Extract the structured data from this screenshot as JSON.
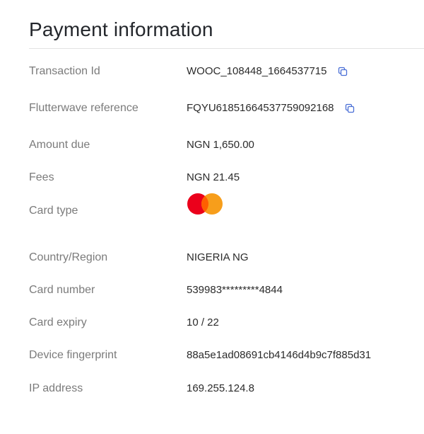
{
  "title": "Payment information",
  "colors": {
    "label": "#7b7b7b",
    "value": "#2b2b2b",
    "copy_icon": "#4a6fd6",
    "mastercard_red": "#eb001b",
    "mastercard_orange": "#f79e1b",
    "mastercard_overlap": "#ff5f00"
  },
  "fields": {
    "transaction_id": {
      "label": "Transaction Id",
      "value": "WOOC_108448_1664537715",
      "icon": "copy-icon"
    },
    "flutterwave_reference": {
      "label": "Flutterwave reference",
      "value": "FQYU618516645377590921​68",
      "icon": "copy-icon"
    },
    "amount_due": {
      "label": "Amount due",
      "value": "NGN 1,650.00"
    },
    "fees": {
      "label": "Fees",
      "value": "NGN 21.45"
    },
    "card_type": {
      "label": "Card type",
      "icon": "mastercard-logo-icon"
    },
    "country_region": {
      "label": "Country/Region",
      "value": "NIGERIA NG"
    },
    "card_number": {
      "label": "Card number",
      "value": "539983*********4844"
    },
    "card_expiry": {
      "label": "Card expiry",
      "value": "10 / 22"
    },
    "device_fingerprint": {
      "label": "Device fingerprint",
      "value": "88a5e1ad08691cb4146d4b9c7f885d31"
    },
    "ip_address": {
      "label": "IP address",
      "value": "169.255.124.8"
    }
  }
}
